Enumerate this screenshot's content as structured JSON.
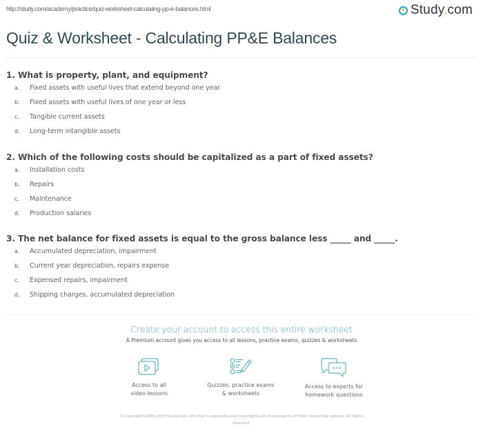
{
  "header": {
    "url": "http://study.com/academy/practice/quiz-worksheet-calculating-pp-e-balances.html",
    "logo_text_main": "Study",
    "logo_text_dot": ".",
    "logo_text_tld": "com",
    "logo_icon": "play-circle-icon"
  },
  "page": {
    "title": "Quiz & Worksheet - Calculating PP&E Balances"
  },
  "questions": [
    {
      "text": "1. What is property, plant, and equipment?",
      "options": [
        {
          "letter": "a.",
          "text": "Fixed assets with useful lives that extend beyond one year"
        },
        {
          "letter": "b.",
          "text": "Fixed assets with useful lives of one year or less"
        },
        {
          "letter": "c.",
          "text": "Tangible current assets"
        },
        {
          "letter": "d.",
          "text": "Long-term intangible assets"
        }
      ]
    },
    {
      "text": "2. Which of the following costs should be capitalized as a part of fixed assets?",
      "options": [
        {
          "letter": "a.",
          "text": "Installation costs"
        },
        {
          "letter": "b.",
          "text": "Repairs"
        },
        {
          "letter": "c.",
          "text": "Maintenance"
        },
        {
          "letter": "d.",
          "text": "Production salaries"
        }
      ]
    },
    {
      "text": "3. The net balance for fixed assets is equal to the gross balance less _____ and _____.",
      "options": [
        {
          "letter": "a.",
          "text": "Accumulated depreciation, impairment"
        },
        {
          "letter": "b.",
          "text": "Current year depreciation, repairs expense"
        },
        {
          "letter": "c.",
          "text": "Expensed repairs, impairment"
        },
        {
          "letter": "d.",
          "text": "Shipping charges, accumulated depreciation"
        }
      ]
    }
  ],
  "promo": {
    "heading": "Create your account to access this entire worksheet",
    "subheading": "A Premium account gives you access to all lessons, practice exams, quizzes & worksheets",
    "accent_color": "#4aa6b6",
    "features": [
      {
        "icon": "video-lessons-icon",
        "line1": "Access to all",
        "line2": "video lessons"
      },
      {
        "icon": "quiz-checklist-icon",
        "line1": "Quizzes, practice exams",
        "line2": "& worksheets"
      },
      {
        "icon": "chat-bubbles-icon",
        "line1": "Access to experts for",
        "line2": "homework questions"
      }
    ]
  },
  "footer": {
    "copyright_line1": "© copyright 2003-2020 Study.com. All other trademarks and copyrights are the property of their respective owners. All rights",
    "copyright_line2": "reserved."
  }
}
